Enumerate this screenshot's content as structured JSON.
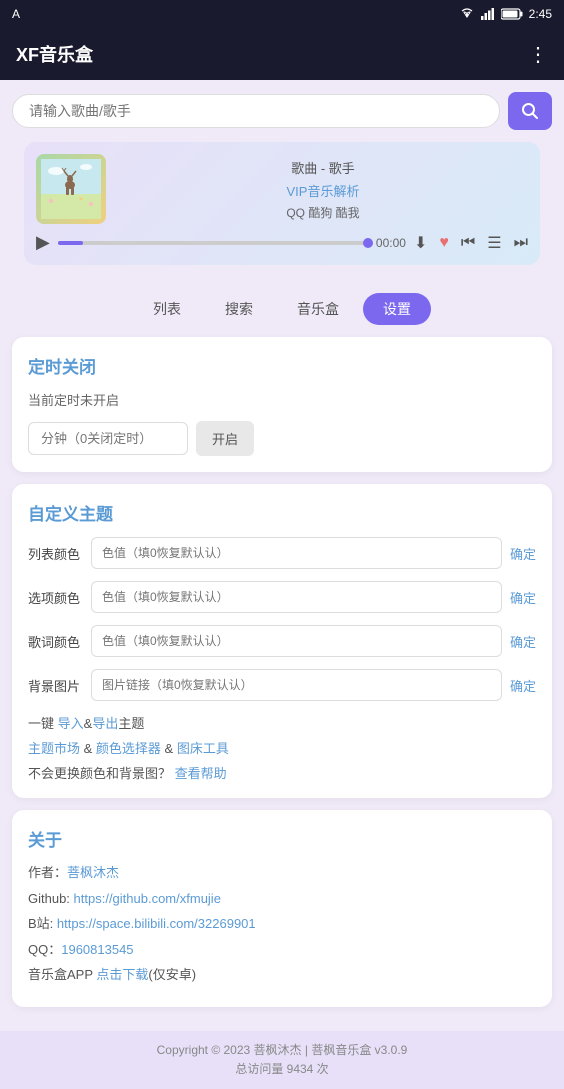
{
  "statusBar": {
    "appIcon": "A",
    "time": "2:45",
    "wifiIcon": "wifi",
    "signalIcon": "signal",
    "batteryIcon": "battery"
  },
  "header": {
    "title": "XF音乐盒",
    "menuIcon": "⋮"
  },
  "search": {
    "placeholder": "请输入歌曲/歌手",
    "searchIcon": "🔍"
  },
  "player": {
    "songTitle": "歌曲 - 歌手",
    "vipText": "VIP音乐解析",
    "sources": "QQ 酷狗 酷我",
    "time": "00:00",
    "playIcon": "▶",
    "downloadIcon": "⬇",
    "favoriteIcon": "♥",
    "prevIcon": "⏮",
    "listIcon": "☰",
    "nextIcon": "⏭"
  },
  "tabs": [
    {
      "id": "list",
      "label": "列表"
    },
    {
      "id": "search",
      "label": "搜索"
    },
    {
      "id": "musicbox",
      "label": "音乐盒"
    },
    {
      "id": "settings",
      "label": "设置",
      "active": true
    }
  ],
  "timer": {
    "title": "定时关闭",
    "status": "当前定时未开启",
    "inputPlaceholder": "分钟（0关闭定时）",
    "enableBtn": "开启"
  },
  "theme": {
    "title": "自定义主题",
    "listColor": {
      "label": "列表颜色",
      "placeholder": "色值（填0恢复默认认）",
      "confirmBtn": "确定"
    },
    "optionColor": {
      "label": "选项颜色",
      "placeholder": "色值（填0恢复默认认）",
      "confirmBtn": "确定"
    },
    "lyricsColor": {
      "label": "歌词颜色",
      "placeholder": "色值（填0恢复默认认）",
      "confirmBtn": "确定"
    },
    "bgImage": {
      "label": "背景图片",
      "placeholder": "图片链接（填0恢复默认认）",
      "confirmBtn": "确定"
    },
    "importExportText": "一键 导入&导出主题",
    "importLink": "导入",
    "exportLink": "导出",
    "marketText": "主题市场",
    "colorPickerText": "颜色选择器",
    "bedToolText": "图床工具",
    "helpText": "不会更换颜色和背景图？",
    "helpLink": "查看帮助"
  },
  "about": {
    "title": "关于",
    "author": "作者：菩枫沐杰",
    "authorLink": "菩枫沐杰",
    "github": "Github: https://github.com/xfmujie",
    "githubLink": "https://github.com/xfmujie",
    "bilibili": "B站: https://space.bilibili.com/32269901",
    "biliLink": "https://space.bilibili.com/32269901",
    "qq": "QQ：1960813545",
    "qqLink": "1960813545",
    "appDownload": "音乐盒APP 点击下载(仅安卓)"
  },
  "footer": {
    "copyright": "Copyright © 2023 菩枫沐杰 | 菩枫音乐盒 v3.0.9",
    "visits": "总访问量 9434 次"
  }
}
